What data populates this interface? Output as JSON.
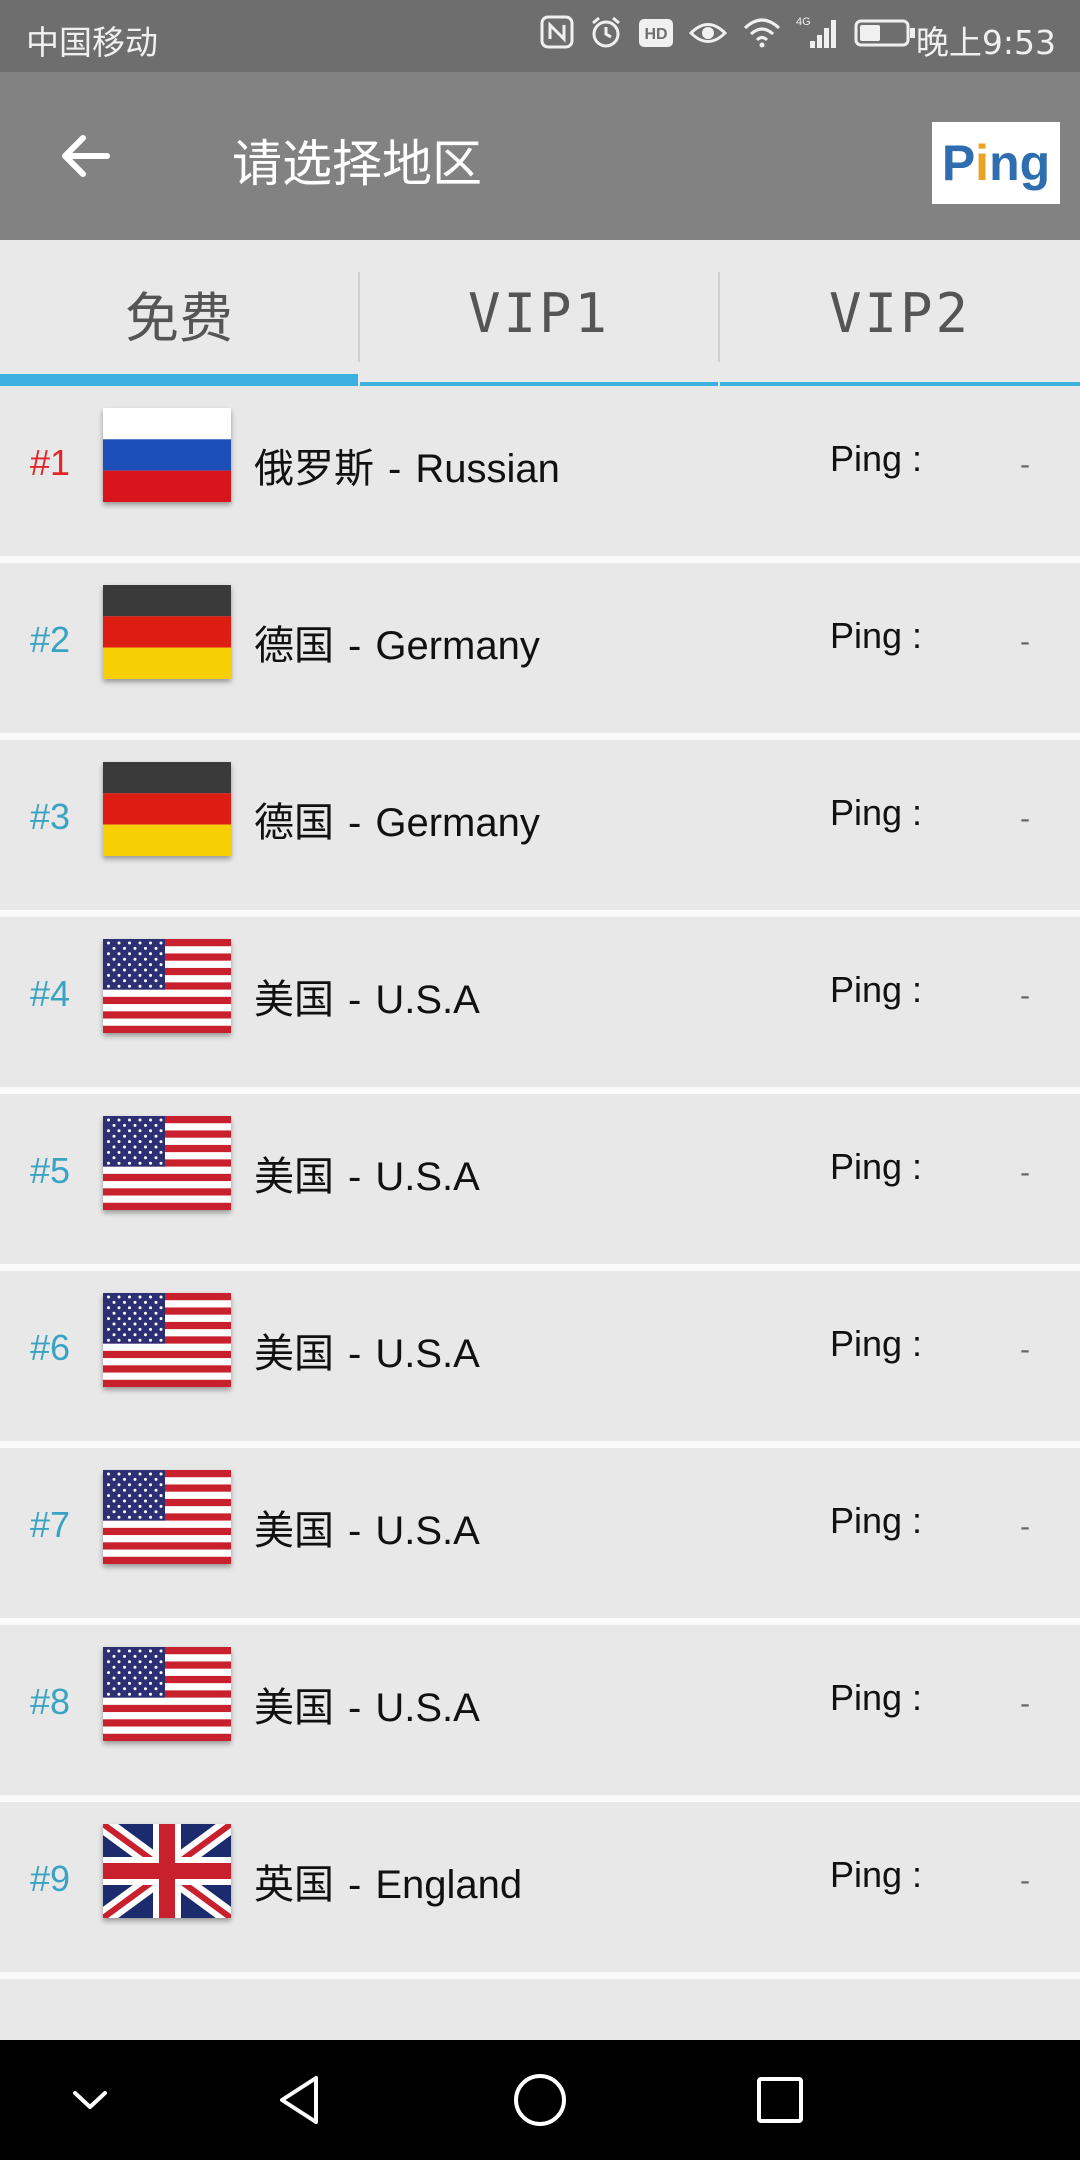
{
  "status_bar": {
    "carrier": "中国移动",
    "time": "晚上9:53",
    "network": "4G",
    "hd": "HD",
    "icons": [
      "nfc-icon",
      "alarm-icon",
      "hd-icon",
      "eye-icon",
      "wifi-icon",
      "signal-icon",
      "battery-icon"
    ]
  },
  "toolbar": {
    "title": "请选择地区",
    "ping_button": {
      "pre": "P",
      "dot": "i",
      "post": "ng"
    }
  },
  "tabs": [
    {
      "label": "免费",
      "active": true
    },
    {
      "label": "VIP1",
      "active": false
    },
    {
      "label": "VIP2",
      "active": false
    }
  ],
  "colors": {
    "accent": "#3cb0df",
    "rank_top": "#e0262a",
    "rank": "#3aa3c4",
    "toolbar": "#828283",
    "status_bar": "#6e6e6e"
  },
  "servers": [
    {
      "rank": "#1",
      "cn": "俄罗斯",
      "sep": "-",
      "en": "Russian",
      "flag": "russia",
      "ping_label": "Ping :",
      "ping": "-"
    },
    {
      "rank": "#2",
      "cn": "德国",
      "sep": "-",
      "en": "Germany",
      "flag": "germany",
      "ping_label": "Ping :",
      "ping": "-"
    },
    {
      "rank": "#3",
      "cn": "德国",
      "sep": "-",
      "en": "Germany",
      "flag": "germany",
      "ping_label": "Ping :",
      "ping": "-"
    },
    {
      "rank": "#4",
      "cn": "美国",
      "sep": "-",
      "en": "U.S.A",
      "flag": "usa",
      "ping_label": "Ping :",
      "ping": "-"
    },
    {
      "rank": "#5",
      "cn": "美国",
      "sep": "-",
      "en": "U.S.A",
      "flag": "usa",
      "ping_label": "Ping :",
      "ping": "-"
    },
    {
      "rank": "#6",
      "cn": "美国",
      "sep": "-",
      "en": "U.S.A",
      "flag": "usa",
      "ping_label": "Ping :",
      "ping": "-"
    },
    {
      "rank": "#7",
      "cn": "美国",
      "sep": "-",
      "en": "U.S.A",
      "flag": "usa",
      "ping_label": "Ping :",
      "ping": "-"
    },
    {
      "rank": "#8",
      "cn": "美国",
      "sep": "-",
      "en": "U.S.A",
      "flag": "usa",
      "ping_label": "Ping :",
      "ping": "-"
    },
    {
      "rank": "#9",
      "cn": "英国",
      "sep": "-",
      "en": "England",
      "flag": "uk",
      "ping_label": "Ping :",
      "ping": "-"
    }
  ],
  "navbar": [
    "collapse-icon",
    "back-triangle-icon",
    "home-circle-icon",
    "recents-square-icon"
  ]
}
